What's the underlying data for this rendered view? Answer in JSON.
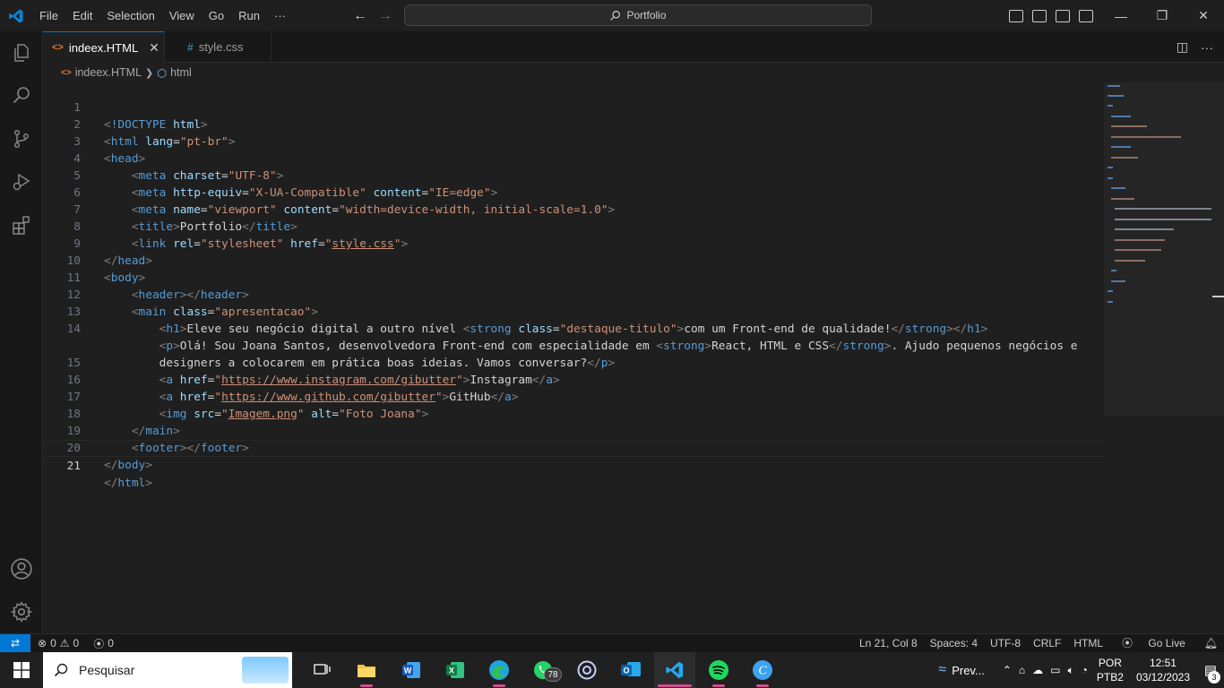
{
  "titlebar": {
    "menu": [
      "File",
      "Edit",
      "Selection",
      "View",
      "Go",
      "Run",
      "···"
    ],
    "command_center": "Portfolio",
    "window_controls": [
      "—",
      "❐",
      "✕"
    ]
  },
  "tabs": [
    {
      "label": "indeex.HTML",
      "icon": "<>",
      "active": true
    },
    {
      "label": "style.css",
      "icon": "#",
      "active": false
    }
  ],
  "breadcrumb": {
    "file": "indeex.HTML",
    "element": "html"
  },
  "editor": {
    "current_line": 21,
    "lines": [
      {
        "n": "1"
      },
      {
        "n": "2"
      },
      {
        "n": "3"
      },
      {
        "n": "4"
      },
      {
        "n": "5"
      },
      {
        "n": "6"
      },
      {
        "n": "7"
      },
      {
        "n": "8"
      },
      {
        "n": "9"
      },
      {
        "n": "10"
      },
      {
        "n": "11"
      },
      {
        "n": "12"
      },
      {
        "n": "13"
      },
      {
        "n": "14"
      },
      {
        "n": ""
      },
      {
        "n": "15"
      },
      {
        "n": "16"
      },
      {
        "n": "17"
      },
      {
        "n": "18"
      },
      {
        "n": "19"
      },
      {
        "n": "20"
      },
      {
        "n": "21"
      }
    ],
    "tokens": {
      "doctype_kw": "!DOCTYPE",
      "doctype_val": "html",
      "html_tag": "html",
      "lang_attr": "lang",
      "lang_val": "\"pt-br\"",
      "head": "head",
      "meta": "meta",
      "charset": "charset",
      "charset_val": "\"UTF-8\"",
      "http_equiv": "http-equiv",
      "http_equiv_val": "\"X-UA-Compatible\"",
      "content": "content",
      "content_val1": "\"IE=edge\"",
      "name": "name",
      "name_val": "\"viewport\"",
      "content_val2": "\"width=device-width, initial-scale=1.0\"",
      "title": "title",
      "title_text": "Portfolio",
      "link": "link",
      "rel": "rel",
      "rel_val": "\"stylesheet\"",
      "href": "href",
      "stylecss": "style.css",
      "body": "body",
      "header": "header",
      "main": "main",
      "class": "class",
      "class_val_main": "\"apresentacao\"",
      "h1": "h1",
      "h1_text": "Eleve seu negócio digital a outro nível ",
      "strong": "strong",
      "class_val_strong": "\"destaque-titulo\"",
      "h1_strong_text": "com um Front-end de qualidade!",
      "p": "p",
      "p_text1": "Olá! Sou Joana Santos, desenvolvedora Front-end com especialidade em ",
      "p_strong_text": "React, HTML e CSS",
      "p_text2": ". Ajudo pequenos negócios e",
      "p_text3": "designers a colocarem em prática boas ideias. Vamos conversar?",
      "a": "a",
      "insta_url": "https://www.instagram.com/gibutter",
      "insta_text": "Instagram",
      "github_url": "https://www.github.com/gibutter",
      "github_text": "GitHub",
      "img": "img",
      "src": "src",
      "img_src": "Imagem.png",
      "alt": "alt",
      "alt_val": "\"Foto Joana\"",
      "footer": "footer"
    }
  },
  "statusbar": {
    "errors": "0",
    "warnings": "0",
    "ports": "0",
    "position": "Ln 21, Col 8",
    "spaces": "Spaces: 4",
    "encoding": "UTF-8",
    "eol": "CRLF",
    "language": "HTML",
    "golive": "Go Live"
  },
  "taskbar": {
    "search_placeholder": "Pesquisar",
    "whatsapp_badge": "78",
    "weather_text": "Prev...",
    "lang_top": "POR",
    "lang_bottom": "PTB2",
    "time": "12:51",
    "date": "03/12/2023",
    "notifications": "3"
  },
  "colors": {
    "accent": "#0078d4",
    "tag": "#569cd6",
    "attr": "#9cdcfe",
    "string": "#ce9178",
    "bracket": "#808080"
  }
}
